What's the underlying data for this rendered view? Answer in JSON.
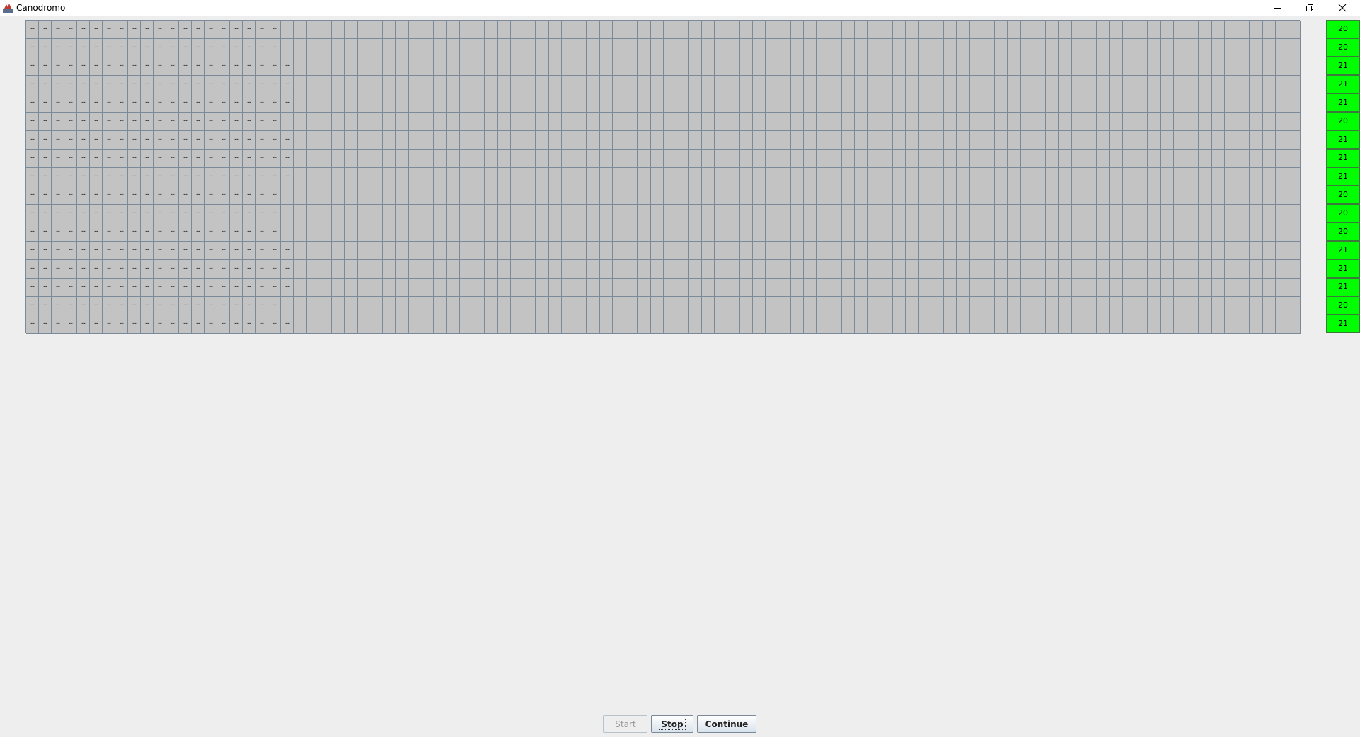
{
  "window": {
    "title": "Canodromo",
    "icon": "java-app-icon"
  },
  "track": {
    "cell_text": "...",
    "lane_count": 17,
    "cells_per_lane": 100,
    "lanes": [
      {
        "position": 20
      },
      {
        "position": 20
      },
      {
        "position": 21
      },
      {
        "position": 21
      },
      {
        "position": 21
      },
      {
        "position": 20
      },
      {
        "position": 21
      },
      {
        "position": 21
      },
      {
        "position": 21
      },
      {
        "position": 20
      },
      {
        "position": 20
      },
      {
        "position": 20
      },
      {
        "position": 21
      },
      {
        "position": 21
      },
      {
        "position": 21
      },
      {
        "position": 20
      },
      {
        "position": 21
      }
    ],
    "colors": {
      "cell_bg": "#c3c3c3",
      "cell_border": "#7a8a99",
      "result_bg": "#00ff00"
    }
  },
  "results": [
    "20",
    "20",
    "21",
    "21",
    "21",
    "20",
    "21",
    "21",
    "21",
    "20",
    "20",
    "20",
    "21",
    "21",
    "21",
    "20",
    "21"
  ],
  "controls": {
    "start_label": "Start",
    "start_enabled": false,
    "stop_label": "Stop",
    "continue_label": "Continue"
  }
}
